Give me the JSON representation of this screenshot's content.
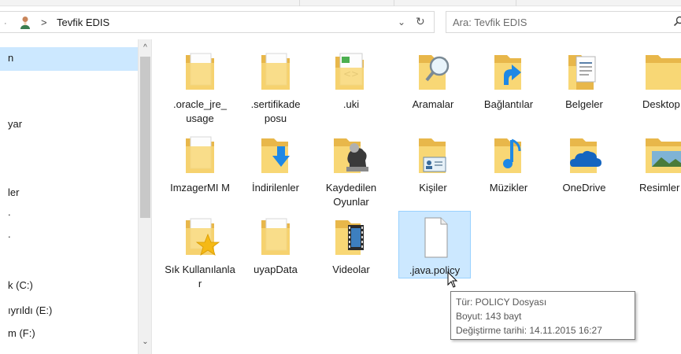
{
  "address": {
    "crumb_separator": ">",
    "folder": "Tevfik EDIS",
    "dropdown_glyph": "⌄",
    "refresh_glyph": "↻",
    "user_icon": "user-folder-icon"
  },
  "search": {
    "placeholder": "Ara: Tevfik EDIS"
  },
  "nav": {
    "items": [
      {
        "label": "n",
        "selected": true
      },
      {
        "label": "yar"
      },
      {
        "label": "ler"
      },
      {
        "label": "."
      },
      {
        "label": "."
      },
      {
        "label": "k (C:)"
      },
      {
        "label": "ıyrıldı (E:)"
      },
      {
        "label": "m (F:)"
      }
    ]
  },
  "scrollbar": {
    "up_glyph": "^",
    "down_glyph": "⌄"
  },
  "files": [
    {
      "label": ".oracle_jre_ usage",
      "icon": "folder-doc-icon"
    },
    {
      "label": ".sertifikade posu",
      "icon": "folder-doc-icon"
    },
    {
      "label": ".uki",
      "icon": "folder-code-icon"
    },
    {
      "label": "Aramalar",
      "icon": "folder-search-icon"
    },
    {
      "label": "Bağlantılar",
      "icon": "folder-links-icon"
    },
    {
      "label": "Belgeler",
      "icon": "folder-documents-icon"
    },
    {
      "label": "Desktop",
      "icon": "folder-desktop-icon"
    },
    {
      "label": "ImzagerMI M",
      "icon": "folder-doc-icon"
    },
    {
      "label": "İndirilenler",
      "icon": "folder-downloads-icon"
    },
    {
      "label": "Kaydedilen Oyunlar",
      "icon": "folder-games-icon"
    },
    {
      "label": "Kişiler",
      "icon": "folder-contacts-icon"
    },
    {
      "label": "Müzikler",
      "icon": "folder-music-icon"
    },
    {
      "label": "OneDrive",
      "icon": "onedrive-icon"
    },
    {
      "label": "Resimler",
      "icon": "folder-pictures-icon"
    },
    {
      "label": "Sık Kullanılanla r",
      "icon": "folder-favorites-icon"
    },
    {
      "label": "uyapData",
      "icon": "folder-doc-icon"
    },
    {
      "label": "Videolar",
      "icon": "folder-videos-icon"
    },
    {
      "label": ".java.policy",
      "icon": "blank-file-icon",
      "selected": true
    }
  ],
  "tooltip": {
    "type": "Tür: POLICY Dosyası",
    "size": "Boyut: 143 bayt",
    "modified": "Değiştirme tarihi: 14.11.2015 16:27"
  },
  "colors": {
    "folder": "#f8d775",
    "folder_dark": "#e8b74a",
    "selection": "#cce8ff",
    "selection_border": "#99d1ff",
    "accent_blue": "#1e88e5"
  }
}
